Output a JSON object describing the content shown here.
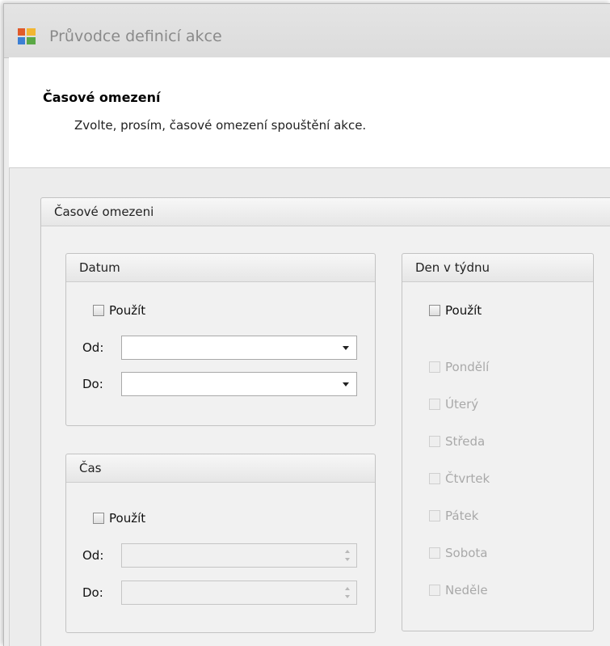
{
  "window": {
    "title": "Průvodce definicí akce"
  },
  "header": {
    "title": "Časové omezení",
    "subtitle": "Zvolte, prosím, časové omezení spouštění akce."
  },
  "outer_group": {
    "label": "Časové omezeni"
  },
  "date_group": {
    "label": "Datum",
    "use_label": "Použít",
    "from_label": "Od:",
    "to_label": "Do:",
    "from_value": "",
    "to_value": ""
  },
  "time_group": {
    "label": "Čas",
    "use_label": "Použít",
    "from_label": "Od:",
    "to_label": "Do:",
    "from_value": "",
    "to_value": ""
  },
  "weekday_group": {
    "label": "Den v týdnu",
    "use_label": "Použít",
    "days": [
      "Pondělí",
      "Úterý",
      "Středa",
      "Čtvrtek",
      "Pátek",
      "Sobota",
      "Neděle"
    ]
  }
}
